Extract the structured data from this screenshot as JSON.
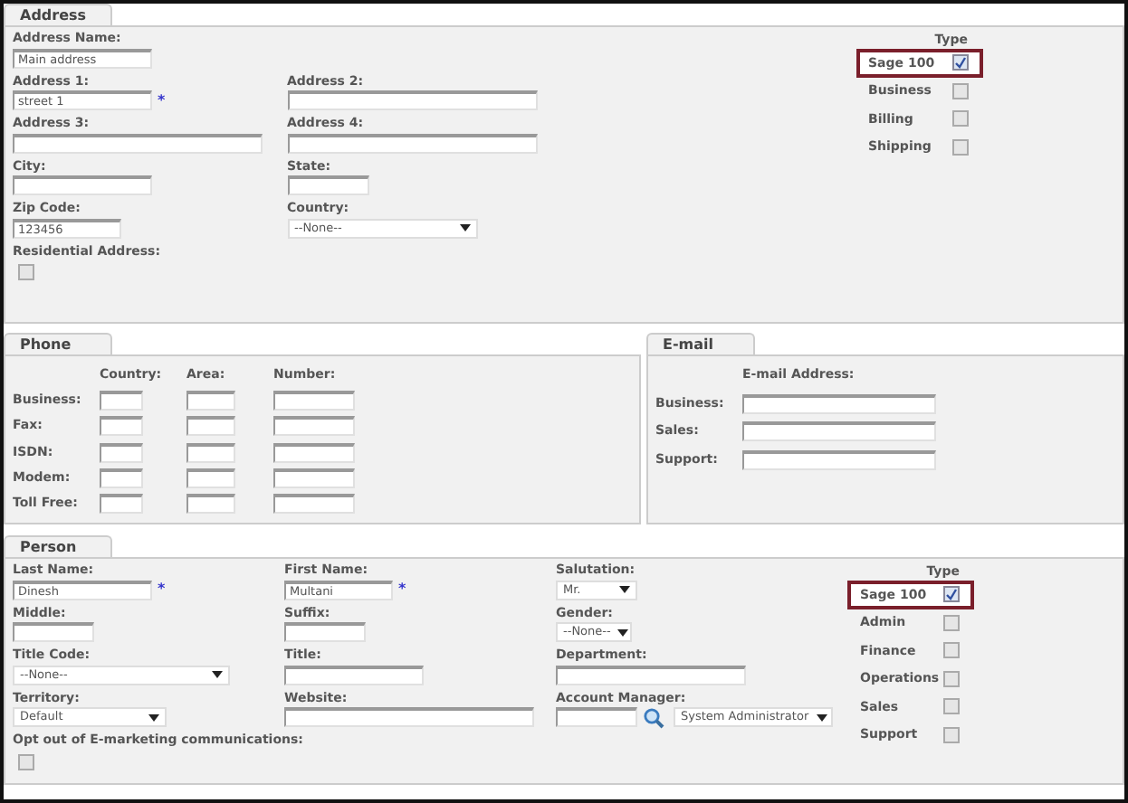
{
  "address": {
    "tab": "Address",
    "rows": [
      [
        {
          "label": "Address Name:",
          "kind": "text",
          "value": "Main address"
        }
      ],
      [
        {
          "label": "Address 1:",
          "kind": "text",
          "value": "street 1",
          "mark": "*"
        },
        {
          "label": "Address 2:",
          "kind": "text"
        }
      ],
      [
        {
          "label": "Address 3:",
          "kind": "text"
        },
        {
          "label": "Address 4:",
          "kind": "text"
        }
      ],
      [
        {
          "label": "City:",
          "kind": "text"
        },
        {
          "label": "State:",
          "kind": "text"
        }
      ],
      [
        {
          "label": "Zip Code:",
          "kind": "text",
          "value": "123456"
        },
        {
          "label": "Country:",
          "kind": "select",
          "value": "--None--"
        }
      ],
      [
        {
          "label": "Residential Address:",
          "kind": "checkbox",
          "checked": false
        }
      ]
    ],
    "type": {
      "heading": "Type",
      "items": [
        {
          "label": "Sage 100",
          "checked": true,
          "highlighted": true
        },
        {
          "label": "Business",
          "checked": false,
          "highlighted": false
        },
        {
          "label": "Billing",
          "checked": false,
          "highlighted": false
        },
        {
          "label": "Shipping",
          "checked": false,
          "highlighted": false
        }
      ]
    }
  },
  "phone": {
    "tab": "Phone",
    "columns": [
      "Country:",
      "Area:",
      "Number:"
    ],
    "rows": [
      "Business:",
      "Fax:",
      "ISDN:",
      "Modem:",
      "Toll Free:"
    ]
  },
  "email": {
    "tab": "E-mail",
    "column": "E-mail Address:",
    "rows": [
      "Business:",
      "Sales:",
      "Support:"
    ]
  },
  "person": {
    "tab": "Person",
    "rows": [
      [
        {
          "label": "Last Name:",
          "kind": "text",
          "value": "Dinesh",
          "mark": "*"
        },
        {
          "label": "First Name:",
          "kind": "text",
          "value": "Multani",
          "mark": "*"
        },
        {
          "label": "Salutation:",
          "kind": "select",
          "value": "Mr."
        }
      ],
      [
        {
          "label": "Middle:",
          "kind": "text"
        },
        {
          "label": "Suffix:",
          "kind": "text"
        },
        {
          "label": "Gender:",
          "kind": "select",
          "value": "--None--"
        }
      ],
      [
        {
          "label": "Title Code:",
          "kind": "select",
          "value": "--None--"
        },
        {
          "label": "Title:",
          "kind": "text"
        },
        {
          "label": "Department:",
          "kind": "text"
        }
      ],
      [
        {
          "label": "Territory:",
          "kind": "select",
          "value": "Default"
        },
        {
          "label": "Website:",
          "kind": "text"
        },
        {
          "label": "Account Manager:",
          "kind": "lookup",
          "value": "System Administrator"
        }
      ],
      [
        {
          "label": "Opt out of E-marketing communications:",
          "kind": "checkbox",
          "checked": false
        }
      ]
    ],
    "type": {
      "heading": "Type",
      "items": [
        {
          "label": "Sage 100",
          "checked": true,
          "highlighted": true
        },
        {
          "label": "Admin",
          "checked": false,
          "highlighted": false
        },
        {
          "label": "Finance",
          "checked": false,
          "highlighted": false
        },
        {
          "label": "Operations",
          "checked": false,
          "highlighted": false
        },
        {
          "label": "Sales",
          "checked": false,
          "highlighted": false
        },
        {
          "label": "Support",
          "checked": false,
          "highlighted": false
        }
      ]
    }
  }
}
